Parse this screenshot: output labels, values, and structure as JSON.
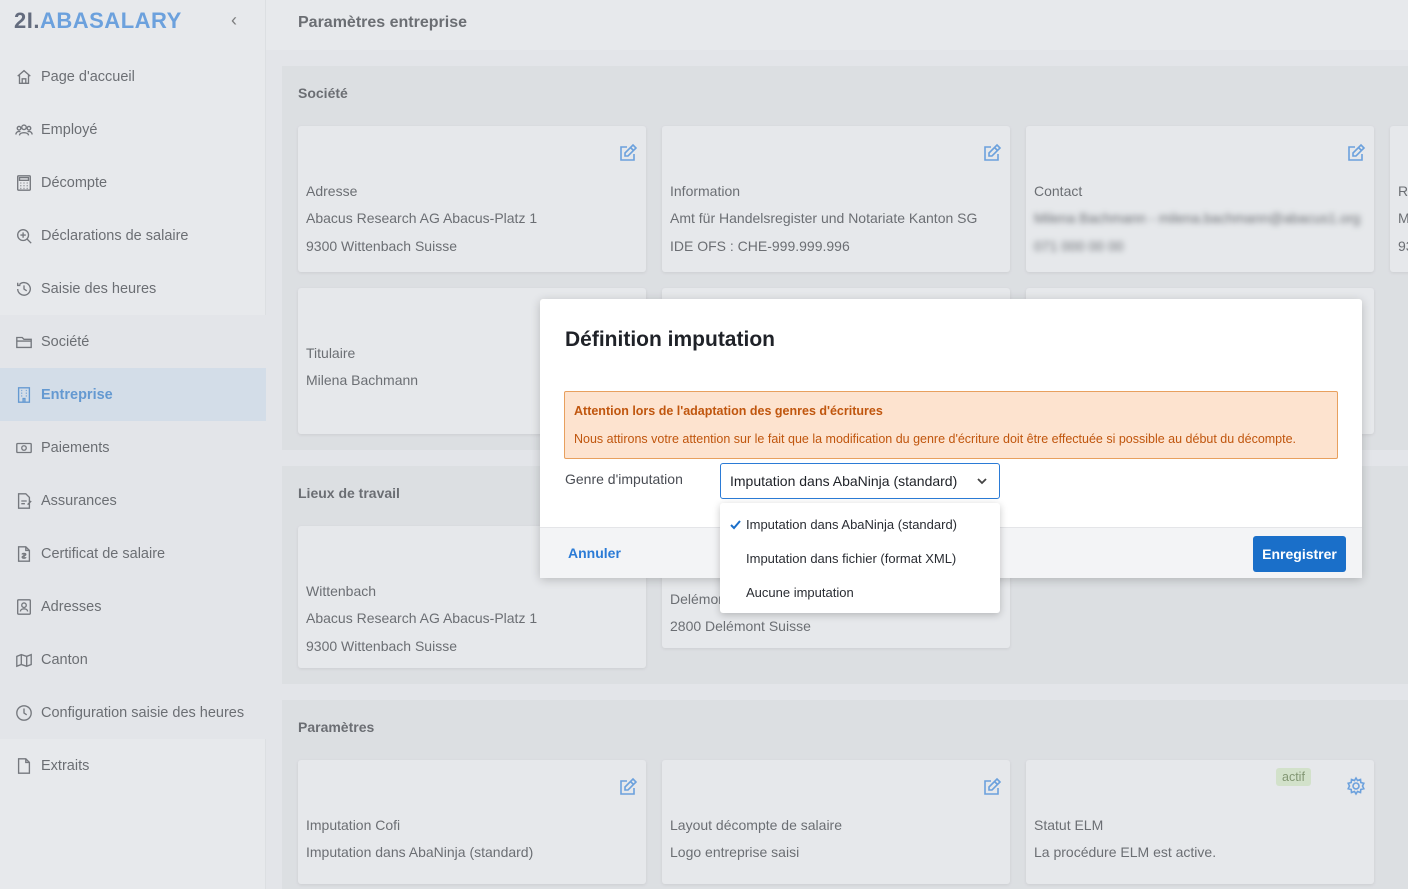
{
  "sidebar": {
    "logo_num": "2I.",
    "logo_brand": "ABASALARY",
    "collapse_icon": "‹",
    "items": [
      {
        "label": "Page d'accueil",
        "icon": "home-icon"
      },
      {
        "label": "Employé",
        "icon": "users-icon"
      },
      {
        "label": "Décompte",
        "icon": "calculator-icon"
      },
      {
        "label": "Déclarations de salaire",
        "icon": "declaration-icon"
      },
      {
        "label": "Saisie des heures",
        "icon": "history-icon"
      },
      {
        "label": "Société",
        "icon": "folder-icon"
      },
      {
        "label": "Entreprise",
        "icon": "building-icon"
      },
      {
        "label": "Paiements",
        "icon": "money-icon"
      },
      {
        "label": "Assurances",
        "icon": "insurance-icon"
      },
      {
        "label": "Certificat de salaire",
        "icon": "certificate-icon"
      },
      {
        "label": "Adresses",
        "icon": "contact-icon"
      },
      {
        "label": "Canton",
        "icon": "map-icon"
      },
      {
        "label": "Configuration saisie des heures",
        "icon": "clock-icon"
      },
      {
        "label": "Extraits",
        "icon": "file-icon"
      }
    ],
    "active_item": "Entreprise"
  },
  "header": {
    "title": "Paramètres entreprise"
  },
  "societe": {
    "title": "Société",
    "cards": [
      {
        "label": "Adresse",
        "line1": "Abacus Research AG  Abacus-Platz 1",
        "line2": "9300 Wittenbach  Suisse"
      },
      {
        "label": "Information",
        "line1": "Amt für Handelsregister und Notariate Kanton SG",
        "line2": "IDE OFS : CHE-999.999.996"
      },
      {
        "label": "Contact",
        "line1": "Milena Bachmann - milena.bachmann@abacus1.org",
        "line2": "071 000 00 00"
      },
      {
        "label": "R",
        "line1": "M",
        "line2": "93"
      },
      {
        "label": "Titulaire",
        "line1": "Milena Bachmann"
      }
    ]
  },
  "lieux": {
    "title": "Lieux de travail",
    "cards": [
      {
        "label": "Wittenbach",
        "line1": "Abacus Research AG  Abacus-Platz 1",
        "line2": "9300 Wittenbach  Suisse"
      },
      {
        "label": "Delémor",
        "line1": "2800 Delémont  Suisse"
      }
    ]
  },
  "parametres": {
    "title": "Paramètres",
    "cards": [
      {
        "label": "Imputation Cofi",
        "line1": "Imputation dans AbaNinja (standard)"
      },
      {
        "label": "Layout décompte de salaire",
        "line1": "Logo entreprise saisi"
      },
      {
        "label": "Statut ELM",
        "line1": "La procédure ELM est active.",
        "badge": "actif"
      }
    ]
  },
  "modal": {
    "title": "Définition imputation",
    "alert_title": "Attention lors de l'adaptation des genres d'écritures",
    "alert_text": "Nous attirons votre attention sur le fait que la modification du genre d'écriture doit être effectuée si possible au début du décompte.",
    "field_label": "Genre d'imputation",
    "select_value": "Imputation dans AbaNinja (standard)",
    "options": [
      {
        "label": "Imputation dans AbaNinja (standard)",
        "selected": true
      },
      {
        "label": "Imputation dans fichier (format XML)",
        "selected": false
      },
      {
        "label": "Aucune imputation",
        "selected": false
      }
    ],
    "cancel_label": "Annuler",
    "save_label": "Enregistrer"
  },
  "colors": {
    "accent": "#2b7bd6",
    "primary_button": "#1a6fc9",
    "warning_bg": "#fde3cf",
    "warning_text": "#c0560e",
    "active_nav_bg": "#c9d7e6",
    "badge_bg": "#c8ddb9"
  }
}
